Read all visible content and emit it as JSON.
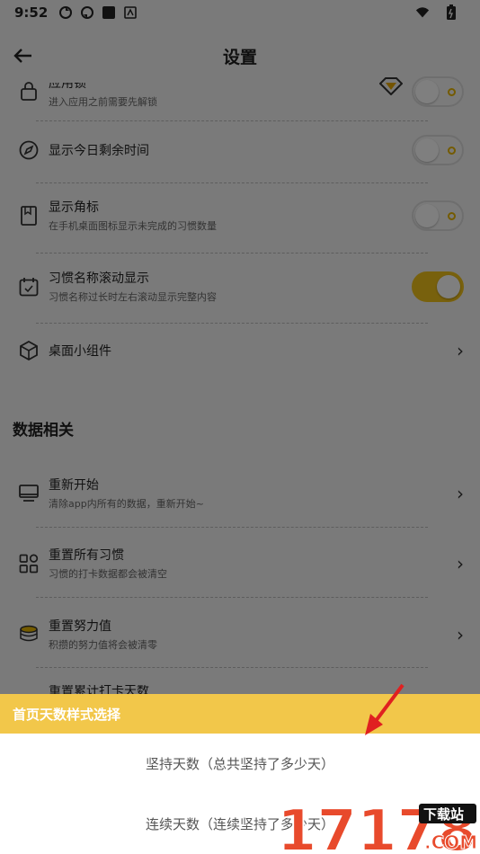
{
  "status_bar": {
    "time": "9:52"
  },
  "header": {
    "title": "设置"
  },
  "settings": {
    "app_lock": {
      "title": "应用锁",
      "desc": "进入应用之前需要先解锁"
    },
    "show_remaining": {
      "title": "显示今日剩余时间"
    },
    "show_badge": {
      "title": "显示角标",
      "desc": "在手机桌面图标显示未完成的习惯数量"
    },
    "scroll_name": {
      "title": "习惯名称滚动显示",
      "desc": "习惯名称过长时左右滚动显示完整内容"
    },
    "widget": {
      "title": "桌面小组件"
    }
  },
  "data_section": {
    "title": "数据相关",
    "restart": {
      "title": "重新开始",
      "desc": "清除app内所有的数据，重新开始~"
    },
    "reset_habits": {
      "title": "重置所有习惯",
      "desc": "习惯的打卡数据都会被清空"
    },
    "reset_effort": {
      "title": "重置努力值",
      "desc": "积攒的努力值将会被清零"
    },
    "reset_total": {
      "title": "重置累计打卡天数"
    }
  },
  "sheet": {
    "title": "首页天数样式选择",
    "options": [
      "坚持天数（总共坚持了多少天）",
      "连续天数（连续坚持了多少天）"
    ]
  },
  "watermark": {
    "text": "17178",
    "badge": "下载站",
    "suffix": ".COM"
  },
  "colors": {
    "accent": "#f2c74a",
    "overlay": "rgba(0,0,0,0.5)"
  }
}
